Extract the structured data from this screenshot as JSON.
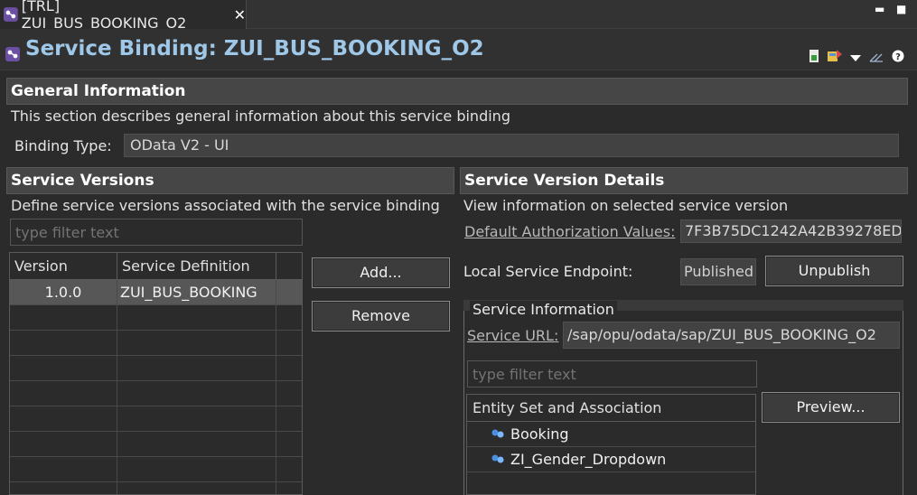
{
  "tab": {
    "label": "[TRL] ZUI_BUS_BOOKING_O2",
    "close": "✕"
  },
  "window_controls": {
    "minimize": "▬",
    "maximize": "■"
  },
  "header": {
    "title": "Service Binding: ZUI_BUS_BOOKING_O2"
  },
  "general": {
    "title": "General Information",
    "description": "This section describes general information about this service binding",
    "binding_type_label": "Binding Type:",
    "binding_type_value": "OData V2 - UI"
  },
  "versions": {
    "title": "Service Versions",
    "description": "Define service versions associated with the service binding",
    "filter_placeholder": "type filter text",
    "columns": [
      "Version",
      "Service Definition"
    ],
    "rows": [
      {
        "version": "1.0.0",
        "definition": "ZUI_BUS_BOOKING"
      }
    ],
    "add_label": "Add...",
    "remove_label": "Remove"
  },
  "details": {
    "title": "Service Version Details",
    "description": "View information on selected service version",
    "auth_label": "Default Authorization Values:",
    "auth_value": "7F3B75DC1242A42B39278ED",
    "endpoint_label": "Local Service Endpoint:",
    "endpoint_status": "Published",
    "unpublish_label": "Unpublish"
  },
  "service_info": {
    "title": "Service Information",
    "url_label": "Service URL:",
    "url_value": "/sap/opu/odata/sap/ZUI_BUS_BOOKING_O2",
    "filter_placeholder": "type filter text",
    "entity_header": "Entity Set and Association",
    "entities": [
      "Booking",
      "ZI_Gender_Dropdown"
    ],
    "preview_label": "Preview..."
  },
  "colors": {
    "title_accent": "#9fc8e8",
    "background": "#2b2b2b",
    "section_header": "#464646",
    "selected_row": "#575757"
  }
}
